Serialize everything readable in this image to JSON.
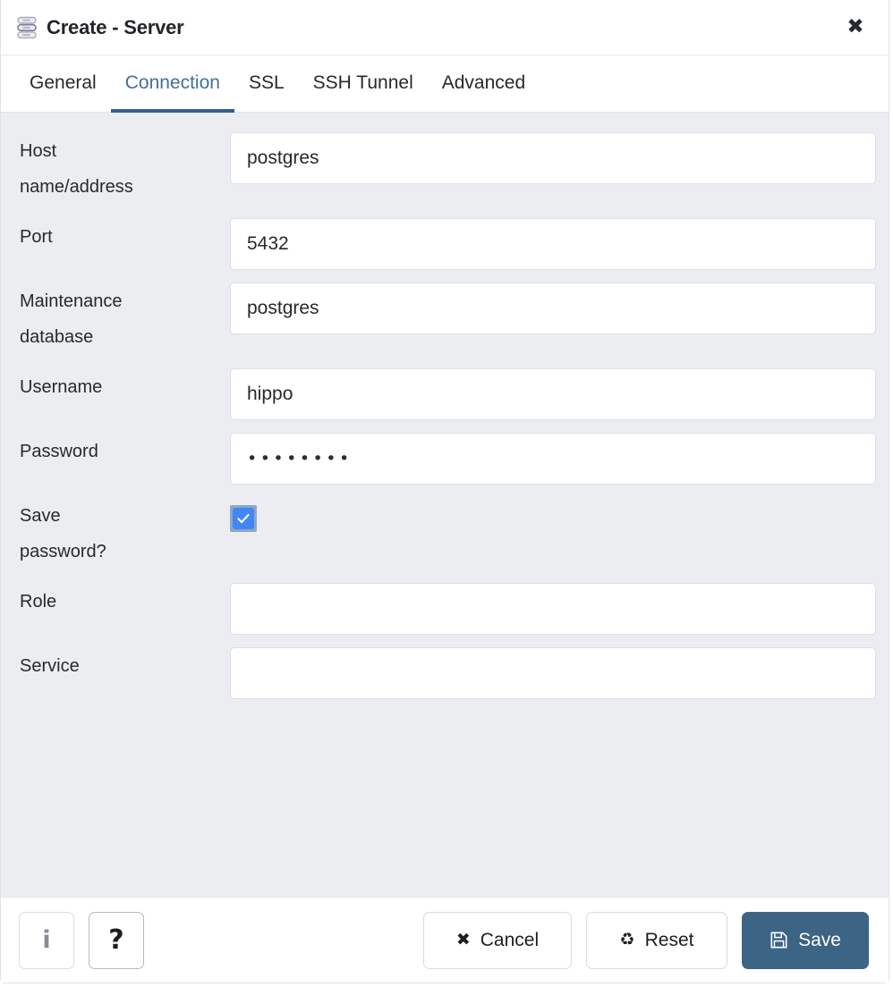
{
  "dialog": {
    "title": "Create - Server",
    "icon": "database-server-icon",
    "close_label": "✖",
    "accent_color": "#33608c",
    "save_button_color": "#3c6485",
    "body_background": "#ecedf1",
    "checkbox_color": "#4285f4"
  },
  "tabs": [
    {
      "label": "General",
      "active": false
    },
    {
      "label": "Connection",
      "active": true
    },
    {
      "label": "SSL",
      "active": false
    },
    {
      "label": "SSH Tunnel",
      "active": false
    },
    {
      "label": "Advanced",
      "active": false
    }
  ],
  "fields": {
    "host": {
      "label_line1": "Host",
      "label_line2": "name/address",
      "value": "postgres",
      "placeholder": ""
    },
    "port": {
      "label_line1": "Port",
      "label_line2": "",
      "value": "5432",
      "placeholder": ""
    },
    "maintenance_db": {
      "label_line1": "Maintenance",
      "label_line2": "database",
      "value": "postgres",
      "placeholder": ""
    },
    "username": {
      "label_line1": "Username",
      "label_line2": "",
      "value": "hippo",
      "placeholder": ""
    },
    "password": {
      "label_line1": "Password",
      "label_line2": "",
      "masked_value": "••••••••",
      "placeholder": ""
    },
    "save_password": {
      "label_line1": "Save",
      "label_line2": "password?",
      "checked": true
    },
    "role": {
      "label_line1": "Role",
      "label_line2": "",
      "value": "",
      "placeholder": ""
    },
    "service": {
      "label_line1": "Service",
      "label_line2": "",
      "value": "",
      "placeholder": ""
    }
  },
  "footer": {
    "info_icon": "info-icon",
    "info_glyph": "i",
    "help_icon": "question-mark-icon",
    "help_glyph": "?",
    "cancel": {
      "label": "Cancel",
      "icon": "close-x-icon",
      "glyph": "✖"
    },
    "reset": {
      "label": "Reset",
      "icon": "recycle-icon",
      "glyph": "♻"
    },
    "save": {
      "label": "Save",
      "icon": "floppy-disk-save-icon",
      "glyph": "💾"
    }
  }
}
